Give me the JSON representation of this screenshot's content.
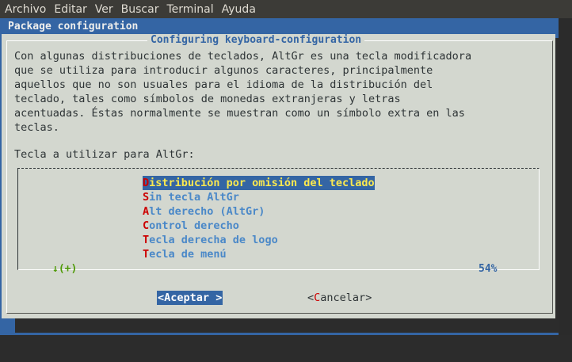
{
  "menubar": {
    "items": [
      "Archivo",
      "Editar",
      "Ver",
      "Buscar",
      "Terminal",
      "Ayuda"
    ]
  },
  "package_title": "Package configuration",
  "dialog": {
    "title": "Configuring keyboard-configuration",
    "description_lines": [
      "Con algunas distribuciones de teclados, AltGr es una tecla modificadora",
      "que se utiliza para introducir algunos caracteres, principalmente",
      "aquellos que no son usuales para el idioma de la distribución del",
      "teclado, tales como símbolos de monedas extranjeras y letras",
      "acentuadas. Éstas normalmente se muestran como un símbolo extra en las",
      "teclas."
    ],
    "prompt": "Tecla a utilizar para AltGr:",
    "options": [
      {
        "hotkey": "D",
        "rest": "istribución por omisión del teclado",
        "selected": true
      },
      {
        "hotkey": "S",
        "rest": "in tecla AltGr",
        "selected": false
      },
      {
        "hotkey": "A",
        "rest": "lt derecho (AltGr)",
        "selected": false
      },
      {
        "hotkey": "C",
        "rest": "ontrol derecho",
        "selected": false
      },
      {
        "hotkey": "T",
        "rest": "ecla derecha de logo",
        "selected": false
      },
      {
        "hotkey": "T",
        "rest": "ecla de menú",
        "selected": false
      }
    ],
    "scroll_indicator": "↓(+)",
    "scroll_percent": "54%",
    "buttons": {
      "ok": {
        "open": "<",
        "hotkey": "A",
        "rest": "ceptar",
        "close": ">"
      },
      "cancel": {
        "open": "<",
        "hotkey": "C",
        "rest": "ancelar",
        "close": ">"
      }
    }
  }
}
